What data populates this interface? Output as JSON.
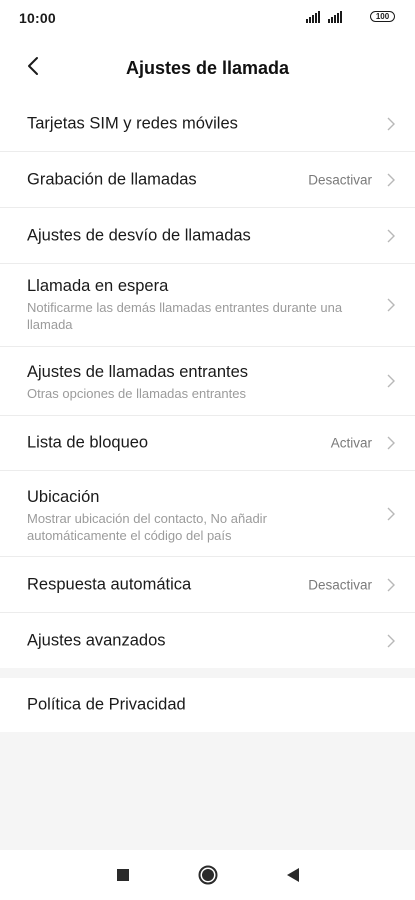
{
  "status_bar": {
    "time": "10:00",
    "battery": "100",
    "icons": [
      "signal-icon",
      "signal-icon",
      "battery-icon"
    ]
  },
  "header": {
    "title": "Ajustes de llamada",
    "back_icon": "back-arrow-icon"
  },
  "settings": [
    {
      "title": "Tarjetas SIM y redes móviles",
      "subtitle": "",
      "value": ""
    },
    {
      "title": "Grabación de llamadas",
      "subtitle": "",
      "value": "Desactivar"
    },
    {
      "title": "Ajustes de desvío de llamadas",
      "subtitle": "",
      "value": ""
    },
    {
      "title": "Llamada en espera",
      "subtitle": "Notificarme las demás llamadas entrantes durante una llamada",
      "value": ""
    },
    {
      "title": "Ajustes de llamadas entrantes",
      "subtitle": "Otras opciones de llamadas entrantes",
      "value": ""
    },
    {
      "title": "Lista de bloqueo",
      "subtitle": "",
      "value": "Activar"
    },
    {
      "title": "Ubicación",
      "subtitle": "Mostrar ubicación del contacto, No añadir automáticamente el código del país",
      "value": ""
    },
    {
      "title": "Respuesta automática",
      "subtitle": "",
      "value": "Desactivar"
    },
    {
      "title": "Ajustes avanzados",
      "subtitle": "",
      "value": ""
    }
  ],
  "privacy": {
    "title": "Política de Privacidad"
  },
  "nav_bar": {
    "buttons": [
      "recents-square-icon",
      "home-circle-icon",
      "back-triangle-icon"
    ]
  }
}
